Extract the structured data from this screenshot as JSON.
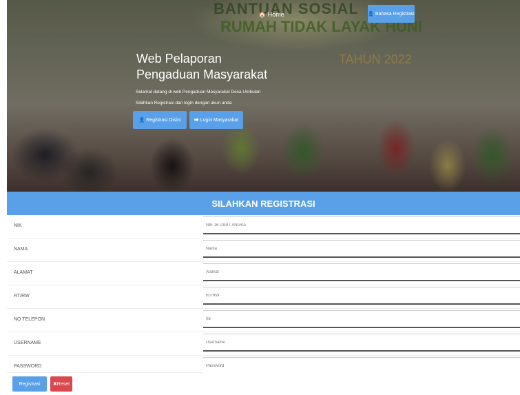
{
  "hero": {
    "home_link": "🏠 Home",
    "banner_button": "👤 Bahasa Registrasi",
    "banner_text_line1": "BANTUAN SOSIAL",
    "banner_text_line2": "RUMAH TIDAK LAYAK HUNI",
    "banner_year": "TAHUN 2022",
    "title_line1": "Web Pelaporan",
    "title_line2": "Pengaduan Masyarakat",
    "subtitle_line1": "Selamat datang di web Pengaduan Masyarakat Desa Umbulan",
    "subtitle_line2": "Silahkan Registrasi dan login dengan akun anda",
    "button_register": "👤 Registrasi Disini",
    "button_login": "⮕ Login Masyarakat"
  },
  "form": {
    "header": "SILAHKAN REGISTRASI",
    "fields": [
      {
        "label": "NIK",
        "placeholder": "NIK 16 DIGIT ANGKA"
      },
      {
        "label": "NAMA",
        "placeholder": "Nama"
      },
      {
        "label": "ALAMAT",
        "placeholder": "Alamat"
      },
      {
        "label": "RT/RW",
        "placeholder": "RT/RW"
      },
      {
        "label": "NO TELEPON",
        "placeholder": "08"
      },
      {
        "label": "USERNAME",
        "placeholder": "Username"
      },
      {
        "label": "PASSWORD",
        "placeholder": "Password"
      }
    ],
    "submit_label": "Registrasi",
    "reset_label": "✖Reset"
  },
  "colors": {
    "primary": "#5aa0e8",
    "danger": "#d9484c"
  }
}
